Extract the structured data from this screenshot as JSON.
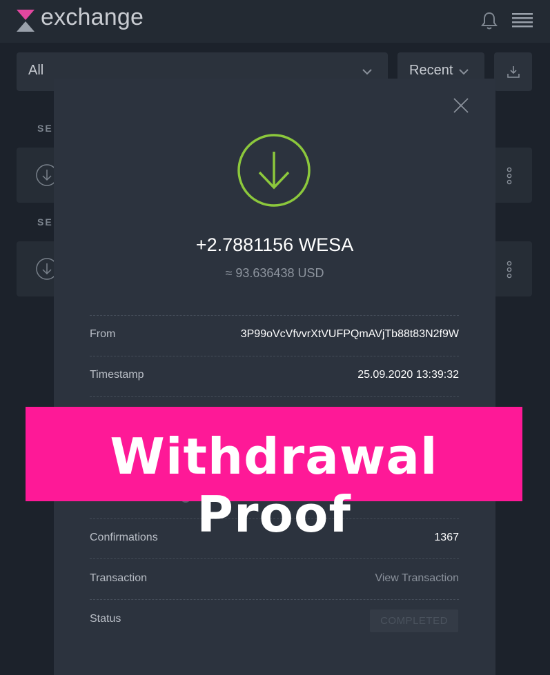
{
  "app": {
    "name": "exchange",
    "brand_colors": {
      "mark_top": "#e2479f",
      "mark_bottom": "#9aa1ab"
    }
  },
  "header_icons": [
    "bell-icon",
    "hamburger-menu-icon"
  ],
  "filters": {
    "type_value": "All",
    "sort_value": "Recent",
    "export_icon": "download-tray-icon"
  },
  "background_list": {
    "section_labels": [
      "SE",
      "SE"
    ],
    "row_icon": "deposit-arrow-icon",
    "row_menu_icon": "vertical-dots-icon"
  },
  "modal": {
    "amount": "+2.7881156 WESA",
    "usd_equivalent": "≈ 93.636438 USD",
    "icon": "deposit-arrow-circle-icon",
    "accent_color": "#8cc83c",
    "fields": {
      "from_label": "From",
      "from_value": "3P99oVcVfvvrXtVUFPQmAVjTb88t83N2f9W",
      "timestamp_label": "Timestamp",
      "timestamp_value": "25.09.2020 13:39:32",
      "confirmations_label": "Confirmations",
      "confirmations_value": "1367",
      "transaction_label": "Transaction",
      "transaction_link": "View Transaction",
      "status_label": "Status",
      "status_value": "COMPLETED"
    }
  },
  "banner": {
    "text": "Withdrawal Proof",
    "color": "#fe1997"
  }
}
